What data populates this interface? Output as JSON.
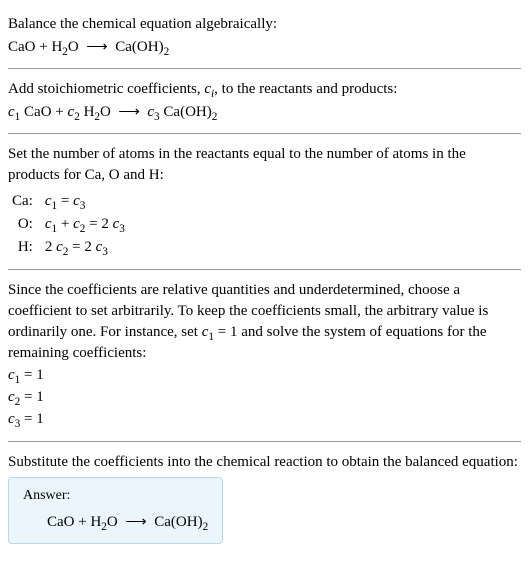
{
  "step1": {
    "text": "Balance the chemical equation algebraically:",
    "equation_html": "CaO + H<sub>2</sub>O&nbsp;&nbsp;⟶&nbsp;&nbsp;Ca(OH)<sub>2</sub>"
  },
  "step2": {
    "text_html": "Add stoichiometric coefficients, <span class='var'>c<sub class='subscript-i'>i</sub></span>, to the reactants and products:",
    "equation_html": "<span class='var'>c</span><sub>1</sub> CaO + <span class='var'>c</span><sub>2</sub> H<sub>2</sub>O&nbsp;&nbsp;⟶&nbsp;&nbsp;<span class='var'>c</span><sub>3</sub> Ca(OH)<sub>2</sub>"
  },
  "step3": {
    "text": "Set the number of atoms in the reactants equal to the number of atoms in the products for Ca, O and H:",
    "rows": [
      {
        "label": "Ca:",
        "eq_html": "<span class='var'>c</span><sub>1</sub> = <span class='var'>c</span><sub>3</sub>"
      },
      {
        "label": "O:",
        "eq_html": "<span class='var'>c</span><sub>1</sub> + <span class='var'>c</span><sub>2</sub> = 2 <span class='var'>c</span><sub>3</sub>"
      },
      {
        "label": "H:",
        "eq_html": "2 <span class='var'>c</span><sub>2</sub> = 2 <span class='var'>c</span><sub>3</sub>"
      }
    ]
  },
  "step4": {
    "text_html": "Since the coefficients are relative quantities and underdetermined, choose a coefficient to set arbitrarily. To keep the coefficients small, the arbitrary value is ordinarily one. For instance, set <span class='var'>c</span><sub>1</sub> = 1 and solve the system of equations for the remaining coefficients:",
    "coeffs": [
      "<span class='var'>c</span><sub>1</sub> = 1",
      "<span class='var'>c</span><sub>2</sub> = 1",
      "<span class='var'>c</span><sub>3</sub> = 1"
    ]
  },
  "step5": {
    "text": "Substitute the coefficients into the chemical reaction to obtain the balanced equation:"
  },
  "answer": {
    "label": "Answer:",
    "equation_html": "CaO + H<sub>2</sub>O&nbsp;&nbsp;⟶&nbsp;&nbsp;Ca(OH)<sub>2</sub>"
  }
}
